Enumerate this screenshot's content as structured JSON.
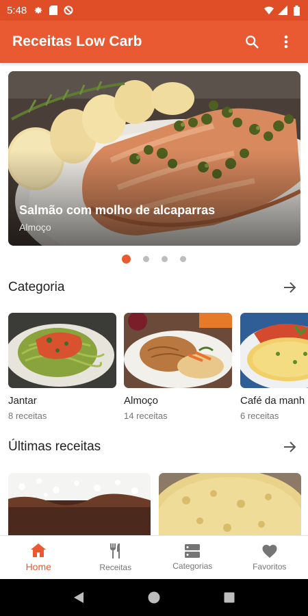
{
  "status_bar": {
    "time": "5:48",
    "left_icons": [
      "gear-icon",
      "sd-card-icon",
      "no-sync-icon"
    ],
    "right_icons": [
      "wifi-icon",
      "signal-icon",
      "battery-icon"
    ]
  },
  "app_bar": {
    "title": "Receitas Low Carb",
    "actions": [
      "search-icon",
      "more-vert-icon"
    ]
  },
  "featured": {
    "title": "Salmão com molho de alcaparras",
    "category": "Almoço",
    "page_count": 4,
    "active_index": 0
  },
  "categories_section": {
    "title": "Categoria",
    "items": [
      {
        "name": "Jantar",
        "count": "8 receitas"
      },
      {
        "name": "Almoço",
        "count": "14 receitas"
      },
      {
        "name": "Café da manh",
        "count": "6 receitas"
      }
    ]
  },
  "recent_section": {
    "title": "Últimas receitas"
  },
  "bottom_nav": {
    "items": [
      {
        "label": "Home",
        "icon": "home-icon",
        "active": true
      },
      {
        "label": "Receitas",
        "icon": "fork-knife-icon",
        "active": false
      },
      {
        "label": "Categorias",
        "icon": "categories-icon",
        "active": false
      },
      {
        "label": "Favoritos",
        "icon": "heart-icon",
        "active": false
      }
    ]
  },
  "colors": {
    "status_bar": "#E04E28",
    "app_bar": "#E95A32",
    "accent": "#E95A32",
    "inactive": "#757575"
  }
}
